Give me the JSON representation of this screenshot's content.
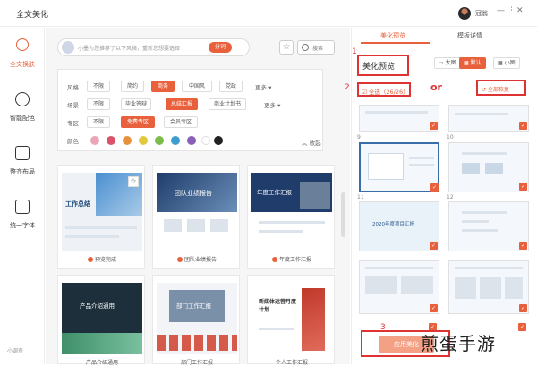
{
  "app": {
    "title": "全文美化",
    "user_name": "冠翁",
    "window_controls": [
      "minimize-icon",
      "more-icon",
      "close-icon"
    ]
  },
  "sidebar": {
    "items": [
      {
        "label": "全文换肤",
        "icon": "skin-icon",
        "active": true
      },
      {
        "label": "智能配色",
        "icon": "palette-icon",
        "active": false
      },
      {
        "label": "整齐布局",
        "icon": "layout-icon",
        "active": false
      },
      {
        "label": "统一字体",
        "icon": "font-icon",
        "active": false
      }
    ],
    "bottom_label": "小调查"
  },
  "search": {
    "tip": "小墨为您推荐了以下风格，重新您想要选择",
    "generate_label": "分词",
    "search_label": "搜索"
  },
  "filters": {
    "rows": [
      {
        "label": "风格",
        "chips": [
          "不限",
          "简约",
          "商务",
          "中国风",
          "党政"
        ],
        "active": "商务",
        "more": "更多"
      },
      {
        "label": "场景",
        "chips": [
          "不限",
          "毕业答辩",
          "总结汇报",
          "商业计划书"
        ],
        "active": "总结汇报",
        "more": "更多"
      },
      {
        "label": "专区",
        "chips": [
          "不限",
          "免费专区",
          "会员专区"
        ],
        "active": "免费专区"
      }
    ],
    "color_label": "颜色",
    "colors": [
      "#e9a6b7",
      "#d9546a",
      "#e8913c",
      "#e2c93c",
      "#7dbb4a",
      "#3b9ecf",
      "#8a5fb8",
      "#ffffff",
      "#222222"
    ],
    "collapse_label": "收起"
  },
  "templates": [
    {
      "caption": "预览完成",
      "title_text": "工作总结"
    },
    {
      "caption": "团队业绩报告",
      "title_text": "团队业绩报告"
    },
    {
      "caption": "年度工作汇报",
      "title_text": "年度工作汇报"
    },
    {
      "caption": "产品介绍通用",
      "title_text": "产品介绍通用"
    },
    {
      "caption": "部门工作汇报",
      "title_text": "部门工作汇报"
    },
    {
      "caption": "个人工作汇报",
      "title_text": "新媒体运营月度计划"
    }
  ],
  "right_panel": {
    "tabs": [
      "美化预览",
      "模板详情"
    ],
    "active_tab": "美化预览",
    "preview_title": "美化预览",
    "view_modes": [
      "大图",
      "默认",
      "小图"
    ],
    "active_view": "默认",
    "select_all": "全选（26/26）",
    "or_text": "or",
    "restore_label": "全部恢复",
    "annotations": [
      "1",
      "2",
      "3"
    ],
    "slide_numbers": [
      "9",
      "10",
      "11",
      "12"
    ],
    "slide_title": "2020年度项目汇报",
    "apply_label": "应用美化"
  },
  "watermark": "煎蛋手游",
  "accent_color": "#e8613c"
}
